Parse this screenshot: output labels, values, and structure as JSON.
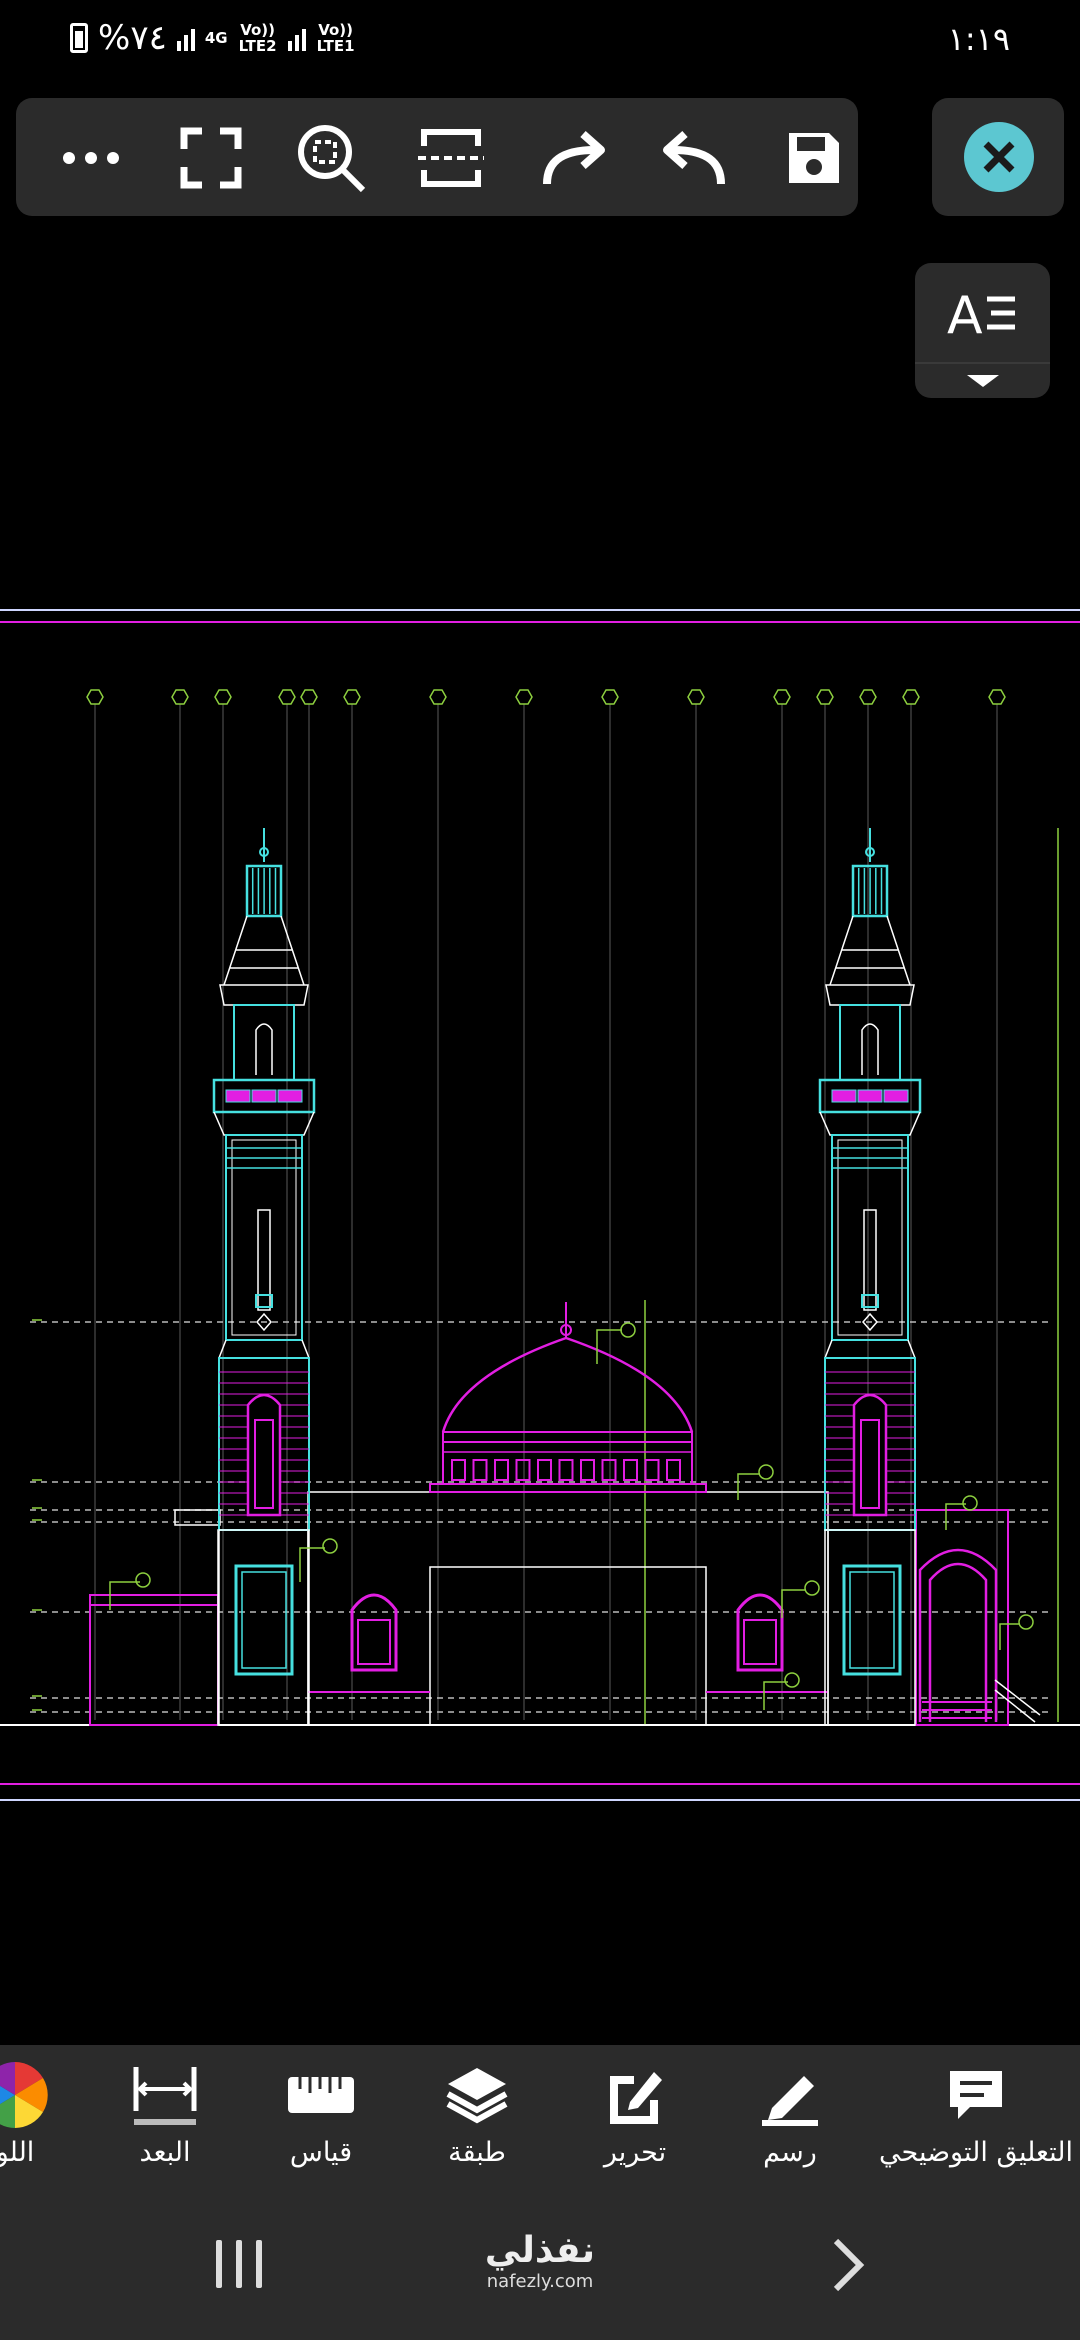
{
  "status_bar": {
    "battery": "%٧٤",
    "network_4g": "4G",
    "lte2": "Vo)) LTE2",
    "lte1": "Vo)) LTE1",
    "time": "١:١٩"
  },
  "toolbar": {
    "items": [
      "more-icon",
      "fullscreen-icon",
      "zoom-extents-icon",
      "viewport-icon",
      "redo-icon",
      "undo-icon",
      "save-icon"
    ],
    "close_icon": "close-icon",
    "text_style_icon": "text-style-icon"
  },
  "drawing": {
    "grid_marker_count": 15,
    "colors": {
      "cyan": "#46e0e0",
      "magenta": "#e21ee2",
      "green": "#8dcf3f",
      "white": "#ffffff",
      "purple": "#a03cc8"
    }
  },
  "bottom_tools": {
    "annotation": "التعليق التوضيحي",
    "draw": "رسم",
    "edit": "تحرير",
    "layer": "طبقة",
    "measure": "قياس",
    "dimension": "البعد",
    "color": "اللو"
  },
  "nav_bar": {
    "logo_ar": "نفذلي",
    "logo_en": "nafezly.com"
  }
}
